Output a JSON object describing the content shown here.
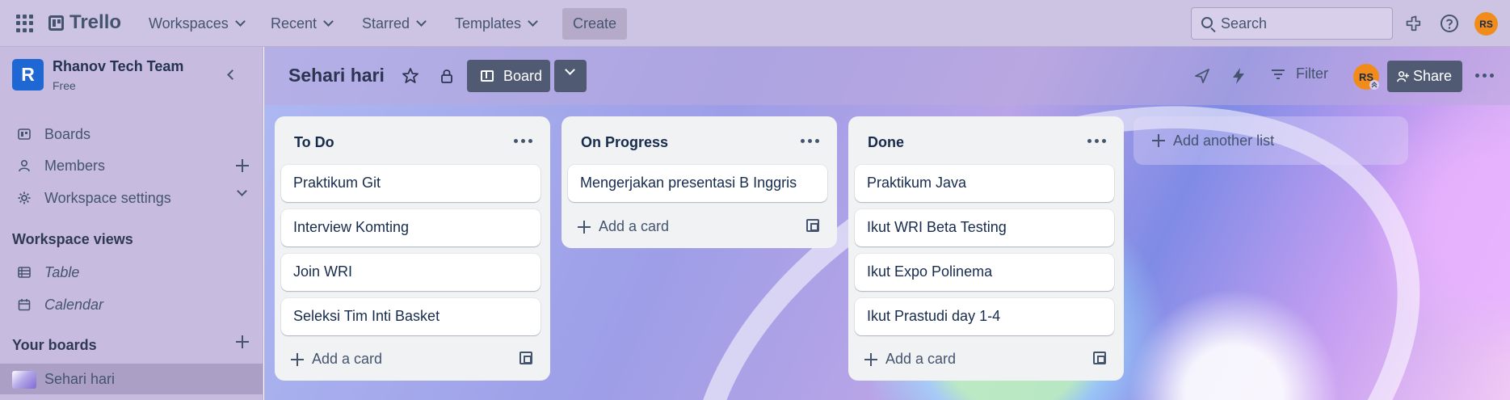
{
  "topbar": {
    "app_name": "Trello",
    "nav": [
      {
        "label": "Workspaces"
      },
      {
        "label": "Recent"
      },
      {
        "label": "Starred"
      },
      {
        "label": "Templates"
      }
    ],
    "create_label": "Create",
    "search_placeholder": "Search",
    "avatar_initials": "RS"
  },
  "sidebar": {
    "workspace_initial": "R",
    "workspace_name": "Rhanov Tech Team",
    "workspace_plan": "Free",
    "items": [
      {
        "label": "Boards"
      },
      {
        "label": "Members"
      },
      {
        "label": "Workspace settings"
      }
    ],
    "views_heading": "Workspace views",
    "views": [
      {
        "label": "Table"
      },
      {
        "label": "Calendar"
      }
    ],
    "boards_heading": "Your boards",
    "boards": [
      {
        "label": "Sehari hari"
      }
    ]
  },
  "board": {
    "title": "Sehari hari",
    "view_label": "Board",
    "filter_label": "Filter",
    "member_initials": "RS",
    "share_label": "Share",
    "add_list_label": "Add another list",
    "lists": [
      {
        "title": "To Do",
        "cards": [
          "Praktikum Git",
          "Interview Komting",
          "Join WRI",
          "Seleksi Tim Inti Basket"
        ],
        "add_card_label": "Add a card"
      },
      {
        "title": "On Progress",
        "cards": [
          "Mengerjakan presentasi B Inggris"
        ],
        "add_card_label": "Add a card"
      },
      {
        "title": "Done",
        "cards": [
          "Praktikum Java",
          "Ikut WRI Beta Testing",
          "Ikut Expo Polinema",
          "Ikut Prastudi day 1-4"
        ],
        "add_card_label": "Add a card"
      }
    ]
  },
  "colors": {
    "topbar": "#cdc3e3",
    "sidebar": "#c7bce0",
    "accent_orange": "#f18c1b",
    "workspace_blue": "#1f67d3",
    "button_dark": "#505b73"
  }
}
